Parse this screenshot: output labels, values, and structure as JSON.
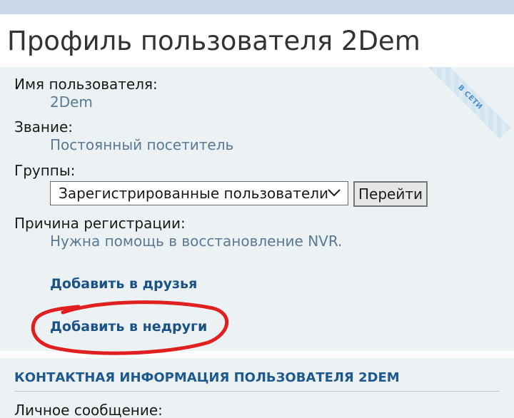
{
  "page": {
    "title": "Профиль пользователя 2Dem"
  },
  "status_ribbon": {
    "text": "В СЕТИ"
  },
  "profile": {
    "username_label": "Имя пользователя:",
    "username_value": "2Dem",
    "rank_label": "Звание:",
    "rank_value": "Постоянный посетитель",
    "groups_label": "Группы:",
    "groups_selected": "Зарегистрированные пользователи",
    "go_button_label": "Перейти",
    "reason_label": "Причина регистрации:",
    "reason_value": "Нужна помощь в восстановление NVR.",
    "add_friend_label": "Добавить в друзья",
    "add_foe_label": "Добавить в недруги"
  },
  "contact": {
    "heading": "КОНТАКТНАЯ ИНФОРМАЦИЯ ПОЛЬЗОВАТЕЛЯ 2DEM",
    "pm_label": "Личное сообщение:"
  },
  "colors": {
    "top_strip": "#c9d8e8",
    "panel_bg": "#ecf1f3",
    "value_text": "#5a7a94",
    "link": "#1a5286",
    "heading": "#1e5a8f",
    "annotation": "#e02020"
  },
  "icons": {
    "select_arrow": "chevron-down-icon"
  }
}
